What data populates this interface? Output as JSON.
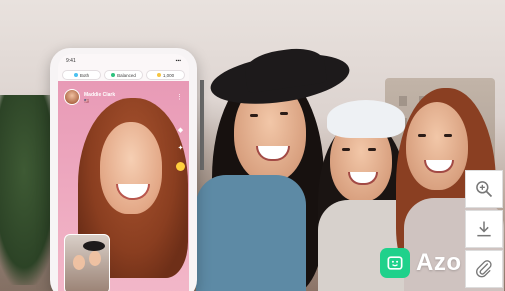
{
  "phone": {
    "status_time": "9:41",
    "status_icons": "▪▪▪",
    "filters": [
      {
        "label": "Both",
        "dot_color": "#4cc1f0"
      },
      {
        "label": "Balanced",
        "dot_color": "#2ec27e"
      },
      {
        "label": "1,000",
        "dot_color": "#f5c542"
      }
    ],
    "caller_name": "Maddie Clark",
    "caller_meta": "🇺🇸",
    "more_icon": "⋮"
  },
  "toolbar": {
    "zoom_icon": "zoom-in-icon",
    "download_icon": "download-icon",
    "attach_icon": "paperclip-icon"
  },
  "brand": {
    "name": "Azo",
    "accent_color": "#1fd18b"
  }
}
